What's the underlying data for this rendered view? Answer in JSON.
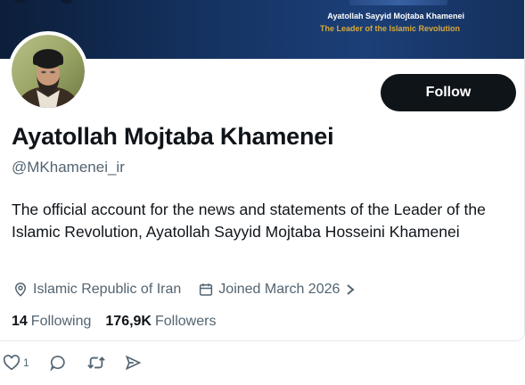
{
  "banner": {
    "line1": "Ayatollah Sayyid Mojtaba Khamenei",
    "line2": "The Leader of the Islamic Revolution",
    "colors": {
      "background": "#163566",
      "line1": "#ffffff",
      "line2": "#d9a93a"
    }
  },
  "profile": {
    "display_name": "Ayatollah Mojtaba Khamenei",
    "handle": "@MKhamenei_ir",
    "bio": "The official account for the news and statements of the Leader of the Islamic Revolution, Ayatollah Sayyid Mojtaba Hosseini Khamenei",
    "location": "Islamic Republic of Iran",
    "joined": "Joined March 2026",
    "following_count": "14",
    "following_label": "Following",
    "followers_count": "176,9K",
    "followers_label": "Followers",
    "avatar_icon": "profile-photo"
  },
  "follow_button": {
    "label": "Follow"
  },
  "post_actions": {
    "like_count": "1",
    "icons": [
      "heart-icon",
      "reply-icon",
      "repost-icon",
      "share-icon"
    ]
  },
  "colors": {
    "primary_text": "#0f1419",
    "secondary_text": "#536471",
    "follow_bg": "#0f1419",
    "follow_text": "#ffffff"
  }
}
